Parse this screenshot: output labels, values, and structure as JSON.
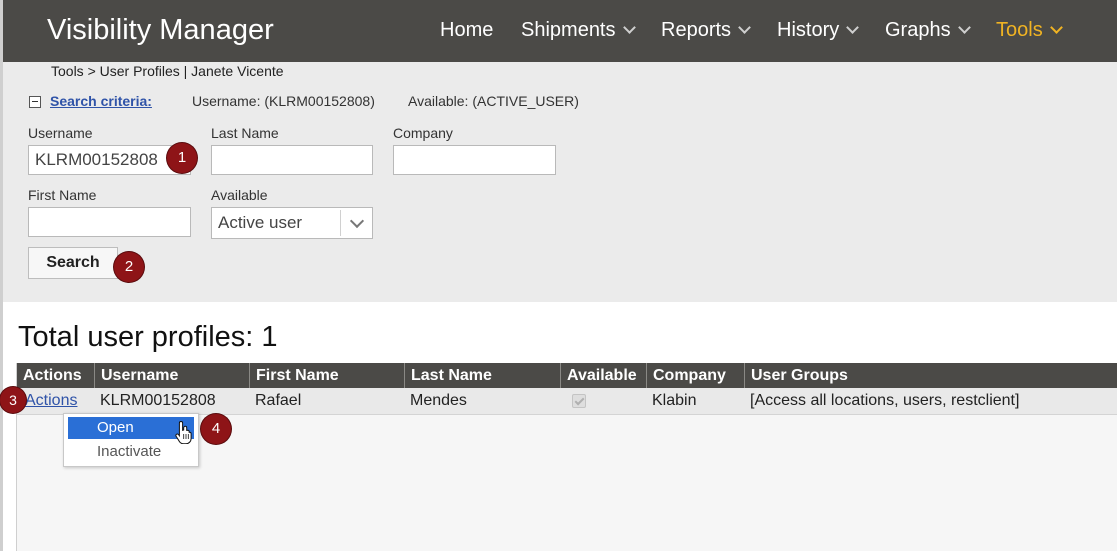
{
  "header": {
    "app_title": "Visibility Manager",
    "nav": [
      {
        "label": "Home",
        "dropdown": false,
        "active": false
      },
      {
        "label": "Shipments",
        "dropdown": true,
        "active": false
      },
      {
        "label": "Reports",
        "dropdown": true,
        "active": false
      },
      {
        "label": "History",
        "dropdown": true,
        "active": false
      },
      {
        "label": "Graphs",
        "dropdown": true,
        "active": false
      },
      {
        "label": "Tools",
        "dropdown": true,
        "active": true
      }
    ],
    "active_color": "#f0b323"
  },
  "breadcrumb": "Tools > User Profiles | Janete Vicente",
  "search_criteria": {
    "link_label": "Search criteria:",
    "username_summary": "Username: (KLRM00152808)",
    "available_summary": "Available: (ACTIVE_USER)"
  },
  "form": {
    "username": {
      "label": "Username",
      "value": "KLRM00152808"
    },
    "last_name": {
      "label": "Last Name",
      "value": ""
    },
    "company": {
      "label": "Company",
      "value": ""
    },
    "first_name": {
      "label": "First Name",
      "value": ""
    },
    "available": {
      "label": "Available",
      "selected": "Active user"
    },
    "search_button": "Search"
  },
  "results": {
    "total_label": "Total user profiles: 1",
    "columns": [
      "Actions",
      "Username",
      "First Name",
      "Last Name",
      "Available",
      "Company",
      "User Groups"
    ],
    "rows": [
      {
        "actions": "Actions",
        "username": "KLRM00152808",
        "first_name": "Rafael",
        "last_name": "Mendes",
        "available": true,
        "company": "Klabin",
        "user_groups": "[Access all locations, users, restclient]"
      }
    ]
  },
  "actions_menu": {
    "items": [
      "Open",
      "Inactivate"
    ],
    "highlighted": "Open"
  },
  "step_badges": [
    "1",
    "2",
    "3",
    "4"
  ],
  "colors": {
    "header_bg": "#4b4a47",
    "panel_bg": "#ebebeb",
    "link": "#2f53a8",
    "badge": "#8e1417",
    "menu_highlight": "#2a6fd6"
  }
}
